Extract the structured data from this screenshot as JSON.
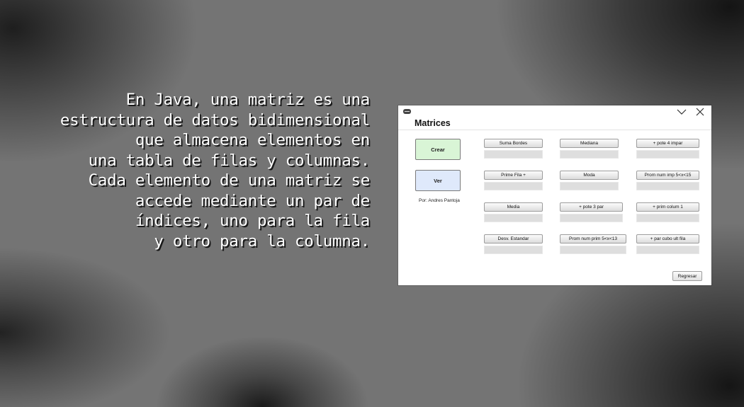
{
  "intro": {
    "lines": [
      "En Java, una matriz es una",
      "estructura de datos bidimensional",
      "que almacena elementos en",
      "una tabla de filas y columnas.",
      "Cada elemento de una matriz se",
      "accede mediante un par de",
      "índices, uno para la fila",
      "y otro para la columna."
    ]
  },
  "window": {
    "title": "Matrices",
    "crear_label": "Crear",
    "ver_label": "Ver",
    "author": "Por: Andres Pantoja",
    "functions": [
      {
        "label": "Suma Bordes",
        "result": ""
      },
      {
        "label": "Mediana",
        "result": ""
      },
      {
        "label": "+ pote 4 impar",
        "result": ""
      },
      {
        "label": "Prime Fila +",
        "result": ""
      },
      {
        "label": "Moda",
        "result": ""
      },
      {
        "label": "Prom num imp 5<x<15",
        "result": ""
      },
      {
        "label": "Media",
        "result": ""
      },
      {
        "label": "+ pote 3 par",
        "result": ""
      },
      {
        "label": "+ prim colum 1",
        "result": ""
      },
      {
        "label": "Desv. Estandar",
        "result": ""
      },
      {
        "label": "Prom num prim 5<x<13",
        "result": ""
      },
      {
        "label": "+ par cubo  ult fila",
        "result": ""
      }
    ],
    "regresar_label": "Regresar",
    "icons": {
      "app": "app-menu-icon",
      "minimize": "chevron-down-icon",
      "close": "close-icon"
    }
  }
}
